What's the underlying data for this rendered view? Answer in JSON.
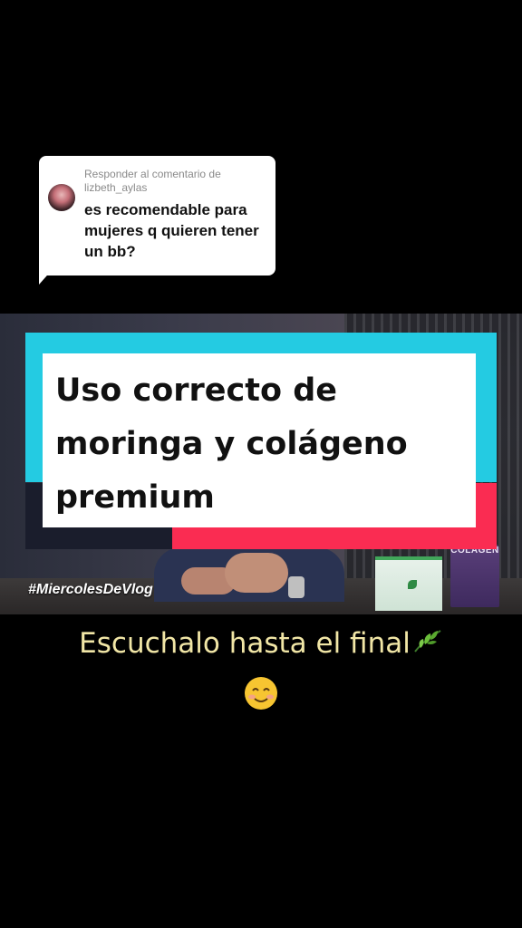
{
  "reply": {
    "header_line1": "Responder al comentario de",
    "username": "lizbeth_aylas",
    "comment": "es recomendable para mujeres q quieren tener un bb?"
  },
  "video": {
    "title": "Uso correcto de moringa y colágeno premium",
    "hashtag": "#MiercolesDeVlog",
    "product_label": "COLÁGEN"
  },
  "caption": {
    "text": "Escuchalo hasta el final",
    "leaf_icon": "herb-leaf-emoji",
    "smile_icon": "smiling-face-emoji"
  },
  "colors": {
    "cyan": "#24cbe2",
    "red": "#fa2c52",
    "caption": "#f1e6a6"
  }
}
